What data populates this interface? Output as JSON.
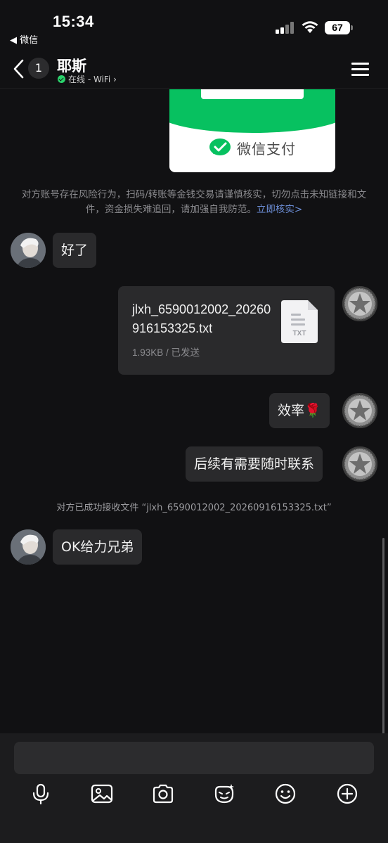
{
  "status_bar": {
    "time": "15:34",
    "back_app": "◀ 微信",
    "battery": "67"
  },
  "header": {
    "unread_count": "1",
    "contact_name": "耶斯",
    "presence": "在线 - WiFi ›"
  },
  "chat": {
    "pay_card": {
      "brand": "微信支付",
      "brand_color": "#07c160"
    },
    "risk_warning": {
      "text": "对方账号存在风险行为，扫码/转账等金钱交易请谨慎核实，切勿点击未知链接和文件，资金损失难追回，请加强自我防范。",
      "link": "立即核实>"
    },
    "messages": [
      {
        "side": "left",
        "text": "好了"
      },
      {
        "side": "right",
        "type": "file",
        "file_name": "jlxh_6590012002_20260916153325.txt",
        "file_meta": "1.93KB / 已发送",
        "file_icon_label": "TXT"
      },
      {
        "side": "right",
        "text": "效率🌹"
      },
      {
        "side": "right",
        "text": "后续有需要随时联系"
      },
      {
        "side": "left",
        "text": "OK给力兄弟"
      }
    ],
    "system_note": "对方已成功接收文件 “jlxh_6590012002_20260916153325.txt”"
  },
  "input_bar": {
    "placeholder": "",
    "tools": [
      "microphone-icon",
      "image-icon",
      "camera-icon",
      "sticker-icon",
      "emoji-icon",
      "plus-icon"
    ]
  }
}
